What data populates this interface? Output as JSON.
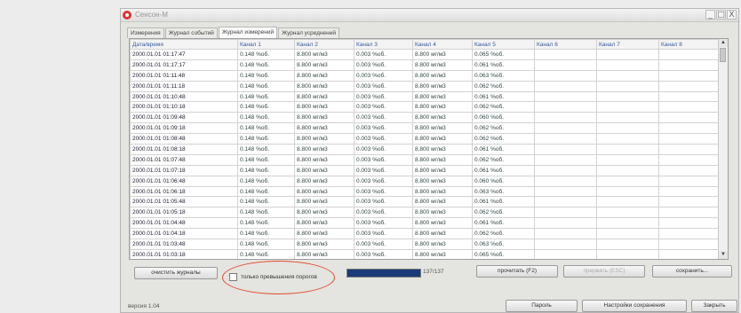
{
  "window": {
    "title": "Сенсон-М",
    "controls": [
      "_",
      "□",
      "X"
    ]
  },
  "tabs": [
    {
      "label": "Измерения",
      "active": false
    },
    {
      "label": "Журнал событий",
      "active": false
    },
    {
      "label": "Журнал измерений",
      "active": true
    },
    {
      "label": "Журнал усреднений",
      "active": false
    }
  ],
  "table": {
    "columns": [
      "Дата/время",
      "Канал 1",
      "Канал 2",
      "Канал 3",
      "Канал 4",
      "Канал 5",
      "Канал 6",
      "Канал 7",
      "Канал 8"
    ],
    "rows": [
      [
        "2000.01.01 01:17:47",
        "0.148 %об.",
        "8.800 мг/м3",
        "0.003 %об.",
        "8.800 мг/м3",
        "0.065 %об.",
        "",
        "",
        ""
      ],
      [
        "2000.01.01 01:17:17",
        "0.148 %об.",
        "8.800 мг/м3",
        "0.003 %об.",
        "8.800 мг/м3",
        "0.061 %об.",
        "",
        "",
        ""
      ],
      [
        "2000.01.01 01:11:48",
        "0.148 %об.",
        "8.800 мг/м3",
        "0.003 %об.",
        "8.800 мг/м3",
        "0.063 %об.",
        "",
        "",
        ""
      ],
      [
        "2000.01.01 01:11:18",
        "0.148 %об.",
        "8.800 мг/м3",
        "0.003 %об.",
        "8.800 мг/м3",
        "0.062 %об.",
        "",
        "",
        ""
      ],
      [
        "2000.01.01 01:10:48",
        "0.148 %об.",
        "8.800 мг/м3",
        "0.003 %об.",
        "8.800 мг/м3",
        "0.061 %об.",
        "",
        "",
        ""
      ],
      [
        "2000.01.01 01:10:18",
        "0.148 %об.",
        "8.800 мг/м3",
        "0.003 %об.",
        "8.800 мг/м3",
        "0.062 %об.",
        "",
        "",
        ""
      ],
      [
        "2000.01.01 01:09:48",
        "0.148 %об.",
        "8.800 мг/м3",
        "0.003 %об.",
        "8.800 мг/м3",
        "0.060 %об.",
        "",
        "",
        ""
      ],
      [
        "2000.01.01 01:09:18",
        "0.148 %об.",
        "8.800 мг/м3",
        "0.003 %об.",
        "8.800 мг/м3",
        "0.062 %об.",
        "",
        "",
        ""
      ],
      [
        "2000.01.01 01:08:48",
        "0.148 %об.",
        "8.800 мг/м3",
        "0.003 %об.",
        "8.800 мг/м3",
        "0.062 %об.",
        "",
        "",
        ""
      ],
      [
        "2000.01.01 01:08:18",
        "0.148 %об.",
        "8.800 мг/м3",
        "0.003 %об.",
        "8.800 мг/м3",
        "0.061 %об.",
        "",
        "",
        ""
      ],
      [
        "2000.01.01 01:07:48",
        "0.148 %об.",
        "8.800 мг/м3",
        "0.003 %об.",
        "8.800 мг/м3",
        "0.062 %об.",
        "",
        "",
        ""
      ],
      [
        "2000.01.01 01:07:18",
        "0.148 %об.",
        "8.800 мг/м3",
        "0.003 %об.",
        "8.800 мг/м3",
        "0.061 %об.",
        "",
        "",
        ""
      ],
      [
        "2000.01.01 01:06:48",
        "0.148 %об.",
        "8.800 мг/м3",
        "0.003 %об.",
        "8.800 мг/м3",
        "0.060 %об.",
        "",
        "",
        ""
      ],
      [
        "2000.01.01 01:06:18",
        "0.148 %об.",
        "8.800 мг/м3",
        "0.003 %об.",
        "8.800 мг/м3",
        "0.063 %об.",
        "",
        "",
        ""
      ],
      [
        "2000.01.01 01:05:48",
        "0.148 %об.",
        "8.800 мг/м3",
        "0.003 %об.",
        "8.800 мг/м3",
        "0.061 %об.",
        "",
        "",
        ""
      ],
      [
        "2000.01.01 01:05:18",
        "0.148 %об.",
        "8.800 мг/м3",
        "0.003 %об.",
        "8.800 мг/м3",
        "0.062 %об.",
        "",
        "",
        ""
      ],
      [
        "2000.01.01 01:04:48",
        "0.148 %об.",
        "8.800 мг/м3",
        "0.003 %об.",
        "8.800 мг/м3",
        "0.061 %об.",
        "",
        "",
        ""
      ],
      [
        "2000.01.01 01:04:18",
        "0.148 %об.",
        "8.800 мг/м3",
        "0.003 %об.",
        "8.800 мг/м3",
        "0.062 %об.",
        "",
        "",
        ""
      ],
      [
        "2000.01.01 01:03:48",
        "0.148 %об.",
        "8.800 мг/м3",
        "0.003 %об.",
        "8.800 мг/м3",
        "0.063 %об.",
        "",
        "",
        ""
      ],
      [
        "2000.01.01 01:03:18",
        "0.148 %об.",
        "8.800 мг/м3",
        "0.003 %об.",
        "8.800 мг/м3",
        "0.065 %об.",
        "",
        "",
        ""
      ]
    ]
  },
  "scrollbar": {
    "up_icon": "▲",
    "down_icon": "▼"
  },
  "controls": {
    "clear_button": "очистить журналы",
    "checkbox_label": "только превышения порогов",
    "checkbox_checked": false,
    "progress_fraction": 1.0,
    "progress_text": "137/137",
    "read_button": "прочитать (F2)",
    "stop_button": "прервать (ESC)",
    "save_button": "сохранить..."
  },
  "footer": {
    "version": "версия 1.04",
    "password_button": "Пароль",
    "save_settings_button": "Настройки сохранения",
    "close_button": "Закрыть"
  },
  "colors": {
    "highlight_ring": "#e04a2a",
    "progress_fill": "#1b3a78",
    "header_text": "#3a5ca0"
  }
}
